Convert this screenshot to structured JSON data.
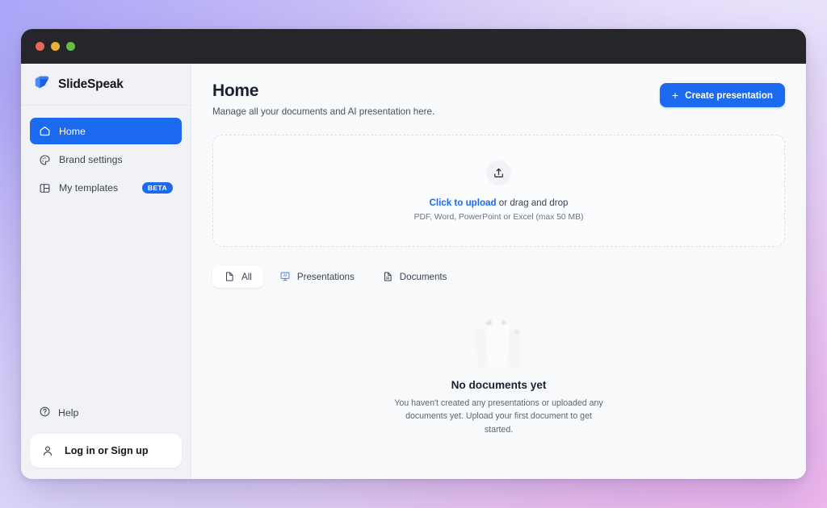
{
  "window": {
    "traffic_lights": [
      "close",
      "minimize",
      "maximize"
    ],
    "titlebar_color": "#26262a"
  },
  "theme": {
    "accent": "#1b6af0",
    "sidebar_bg": "#f1f2f6",
    "content_bg": "#f8f9fb",
    "text_primary": "#1b2030",
    "text_secondary": "#5d6575",
    "page_gradient_from": "#aaa6f8",
    "page_gradient_to": "#eeb7ef"
  },
  "sidebar": {
    "brand": {
      "name": "SlideSpeak",
      "logo_icon": "cube-logo-icon"
    },
    "items": [
      {
        "label": "Home",
        "icon": "house-icon",
        "active": true,
        "badge": null
      },
      {
        "label": "Brand settings",
        "icon": "palette-icon",
        "active": false,
        "badge": null
      },
      {
        "label": "My templates",
        "icon": "layout-panels-icon",
        "active": false,
        "badge": "BETA"
      }
    ],
    "help": {
      "label": "Help",
      "icon": "question-circle-icon"
    },
    "account": {
      "label": "Log in or Sign up",
      "icon": "person-icon"
    }
  },
  "main": {
    "header": {
      "title": "Home",
      "subtitle": "Manage all your documents and AI presentation here.",
      "create_button": {
        "label": "Create presentation",
        "icon": "plus-icon"
      }
    },
    "dropzone": {
      "icon": "upload-icon",
      "link_text": "Click to upload",
      "rest_text": " or drag and drop",
      "hint": "PDF, Word, PowerPoint or Excel (max 50 MB)"
    },
    "tabs": [
      {
        "label": "All",
        "icon": "document-icon",
        "active": true
      },
      {
        "label": "Presentations",
        "icon": "ai-presentation-board-icon",
        "active": false
      },
      {
        "label": "Documents",
        "icon": "document-lines-icon",
        "active": false
      }
    ],
    "empty_state": {
      "illustration": "blank-papers-icon",
      "title": "No documents yet",
      "text": "You haven't created any presentations or uploaded any documents yet. Upload your first document to get started."
    }
  }
}
